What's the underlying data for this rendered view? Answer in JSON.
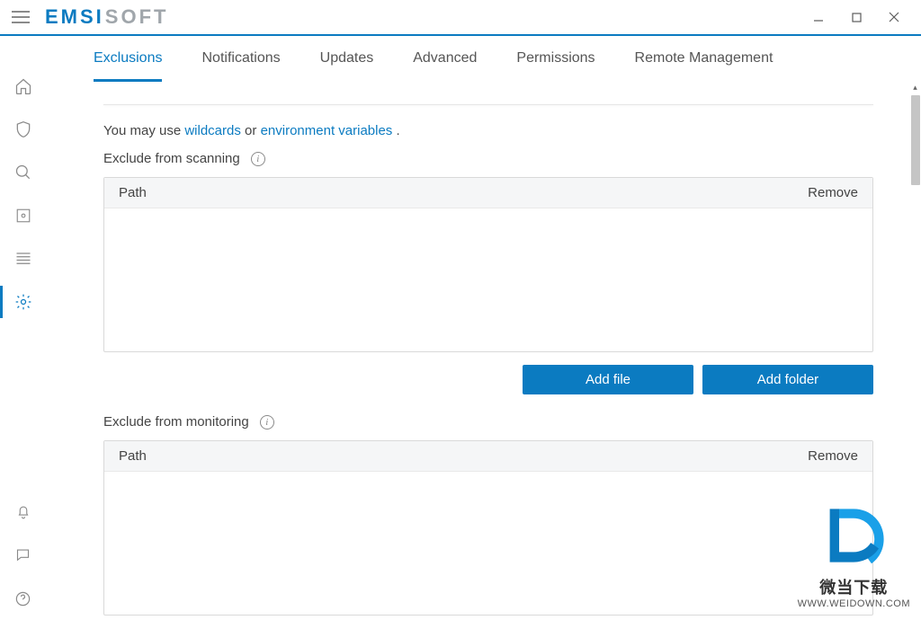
{
  "app": {
    "brand_left": "EMSI",
    "brand_right": "SOFT"
  },
  "tabs": {
    "exclusions": "Exclusions",
    "notifications": "Notifications",
    "updates": "Updates",
    "advanced": "Advanced",
    "permissions": "Permissions",
    "remote": "Remote Management"
  },
  "helper": {
    "pre": "You may use ",
    "link1": "wildcards",
    "mid": " or ",
    "link2": "environment variables",
    "suffix": " ."
  },
  "scan": {
    "label": "Exclude from scanning",
    "col_path": "Path",
    "col_remove": "Remove"
  },
  "monitor": {
    "label": "Exclude from monitoring",
    "col_path": "Path",
    "col_remove": "Remove"
  },
  "buttons": {
    "add_file": "Add file",
    "add_folder": "Add folder"
  },
  "info_glyph": "i",
  "watermark": {
    "text": "微当下载",
    "url": "WWW.WEIDOWN.COM"
  }
}
